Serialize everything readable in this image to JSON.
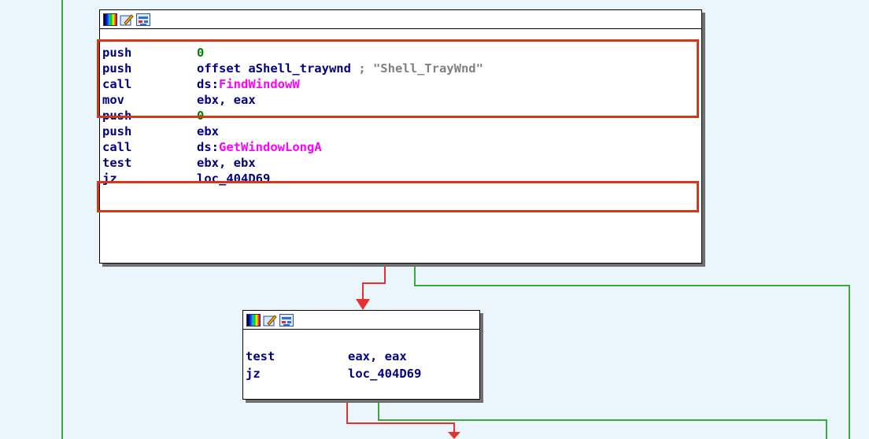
{
  "colors": {
    "background": "#eaf6fb",
    "true_edge": "#3aa83a",
    "false_edge": "#e83030",
    "mnemonic": "#000080",
    "immediate": "#008000",
    "imported_function": "#ff00ff",
    "comment": "#808080",
    "highlight_box": "#d03a1a"
  },
  "node_toolbar_icons": [
    "color-palette-icon",
    "rename-pencil-icon",
    "graph-view-icon"
  ],
  "block1": {
    "rows": [
      {
        "mnemonic": "push",
        "operand": "0",
        "operand_kind": "immediate"
      },
      {
        "mnemonic": "push",
        "operand": "offset aShell_traywnd",
        "comment": "; \"Shell_TrayWnd\""
      },
      {
        "mnemonic": "call",
        "operand_prefix": "ds:",
        "operand": "FindWindowW",
        "operand_kind": "api"
      },
      {
        "mnemonic": "mov",
        "operand": "ebx, eax"
      },
      {
        "mnemonic": "push",
        "operand": "0",
        "operand_kind": "immediate"
      },
      {
        "mnemonic": "push",
        "operand": "ebx"
      },
      {
        "mnemonic": "call",
        "operand_prefix": "ds:",
        "operand": "GetWindowLongA",
        "operand_kind": "api"
      },
      {
        "mnemonic": "test",
        "operand": "ebx, ebx"
      },
      {
        "mnemonic": "jz",
        "operand": "loc_404D69"
      }
    ]
  },
  "block2": {
    "rows": [
      {
        "mnemonic": "test",
        "operand": "eax, eax"
      },
      {
        "mnemonic": "jz",
        "operand": "loc_404D69"
      }
    ]
  }
}
